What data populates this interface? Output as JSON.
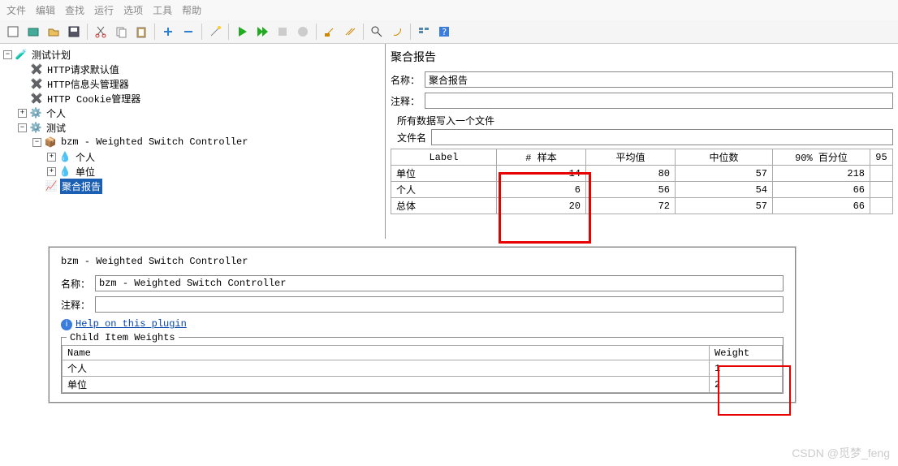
{
  "menu": [
    "文件",
    "编辑",
    "查找",
    "运行",
    "选项",
    "工具",
    "帮助"
  ],
  "tree": {
    "root": "测试计划",
    "n1": "HTTP请求默认值",
    "n2": "HTTP信息头管理器",
    "n3": "HTTP Cookie管理器",
    "n4": "个人",
    "n5": "测试",
    "n6": "bzm - Weighted Switch Controller",
    "n7": "个人",
    "n8": "单位",
    "n9": "聚合报告"
  },
  "report": {
    "title": "聚合报告",
    "name_label": "名称：",
    "name_value": "聚合报告",
    "comment_label": "注释：",
    "comment_value": "",
    "write_all_label": "所有数据写入一个文件",
    "file_label": "文件名",
    "file_value": ""
  },
  "table": {
    "headers": [
      "Label",
      "# 样本",
      "平均值",
      "中位数",
      "90% 百分位",
      "95"
    ],
    "rows": [
      {
        "label": "单位",
        "samples": "14",
        "avg": "80",
        "median": "57",
        "p90": "218"
      },
      {
        "label": "个人",
        "samples": "6",
        "avg": "56",
        "median": "54",
        "p90": "66"
      },
      {
        "label": "总体",
        "samples": "20",
        "avg": "72",
        "median": "57",
        "p90": "66"
      }
    ]
  },
  "controller": {
    "title": "bzm - Weighted Switch Controller",
    "name_label": "名称：",
    "name_value": "bzm - Weighted Switch Controller",
    "comment_label": "注释：",
    "comment_value": "",
    "help_text": "Help on this plugin",
    "weights_title": "Child Item Weights",
    "headers": {
      "name": "Name",
      "weight": "Weight"
    },
    "rows": [
      {
        "name": "个人",
        "weight": "1"
      },
      {
        "name": "单位",
        "weight": "2"
      }
    ]
  },
  "watermark": "CSDN @觅梦_feng"
}
